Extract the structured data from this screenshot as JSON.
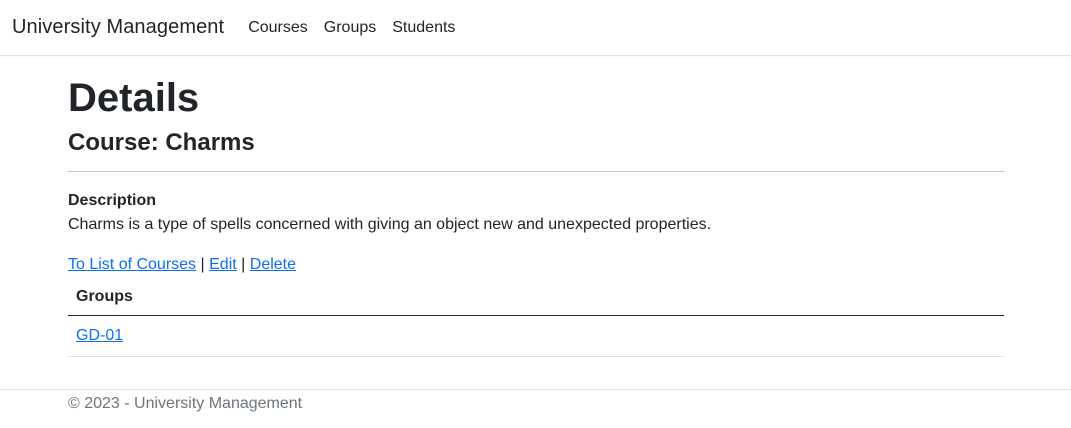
{
  "navbar": {
    "brand": "University Management",
    "links": [
      "Courses",
      "Groups",
      "Students"
    ]
  },
  "main": {
    "title": "Details",
    "subtitle": "Course: Charms",
    "description_label": "Description",
    "description_value": "Charms is a type of spells concerned with giving an object new and unexpected properties.",
    "actions": {
      "back_label": "To List of Courses",
      "separator": "|",
      "edit_label": "Edit",
      "delete_label": "Delete"
    },
    "groups_table": {
      "header": "Groups",
      "rows": [
        "GD-01"
      ]
    }
  },
  "footer": {
    "text": "© 2023 - University Management"
  },
  "colors": {
    "link": "#0d6efd",
    "text": "#212529",
    "muted": "#6c757d"
  }
}
